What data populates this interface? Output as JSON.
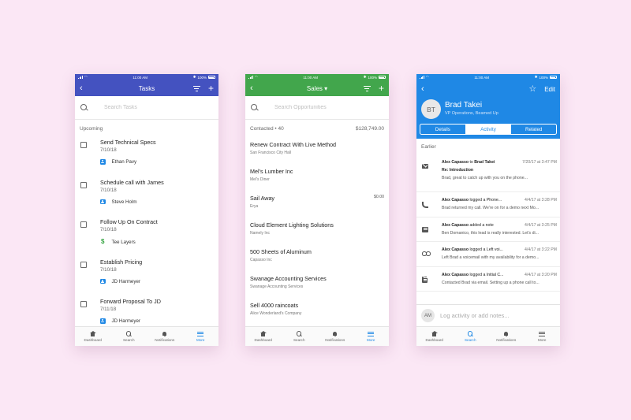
{
  "colors": {
    "background": "#fbe7f5",
    "tasks_accent": "#4452c0",
    "sales_accent": "#42a64c",
    "contact_accent": "#1f88e5"
  },
  "statusbar": {
    "time": "11:00 AM",
    "battery": "100%",
    "bluetooth": "✱"
  },
  "tabbar": {
    "dashboard": "Dashboard",
    "search": "Search",
    "notifications": "Notifications",
    "more": "More"
  },
  "tasks": {
    "title": "Tasks",
    "back": "‹",
    "plus": "+",
    "search_placeholder": "Search Tasks",
    "section": "Upcoming",
    "items": [
      {
        "title": "Send Technical Specs",
        "date": "7/10/18",
        "owner": "Ethan Pavy",
        "owner_icon": "person-icon"
      },
      {
        "title": "Schedule call with James",
        "date": "7/10/18",
        "owner": "Steve Holm",
        "owner_icon": "person-icon"
      },
      {
        "title": "Follow Up On Contract",
        "date": "7/10/18",
        "owner": "Tee Layers",
        "owner_icon": "dollar-icon"
      },
      {
        "title": "Establish Pricing",
        "date": "7/10/18",
        "owner": "JD Harmeyer",
        "owner_icon": "person-icon"
      },
      {
        "title": "Forward Proposal To JD",
        "date": "7/11/18",
        "owner": "JD Harmeyer",
        "owner_icon": "person-icon"
      }
    ]
  },
  "sales": {
    "title": "Sales ▾",
    "back": "‹",
    "plus": "+",
    "search_placeholder": "Search Opportunities",
    "section": "Contacted • 40",
    "section_total": "$128,749.00",
    "items": [
      {
        "title": "Renew Contract With Live Method",
        "sub": "San Francisco City Hall",
        "amount": ""
      },
      {
        "title": "Mel's Lumber Inc",
        "sub": "Mel's Diner",
        "amount": ""
      },
      {
        "title": "Sail Away",
        "sub": "Erya",
        "amount": "$0.00"
      },
      {
        "title": "Cloud Element Lighting Solutions",
        "sub": "Namely Inc",
        "amount": ""
      },
      {
        "title": "500 Sheets of Aluminum",
        "sub": "Capasso Inc",
        "amount": ""
      },
      {
        "title": "Swanage Accounting Services",
        "sub": "Swanage Accounting Services",
        "amount": ""
      },
      {
        "title": "Sell 4000 raincoats",
        "sub": "Alice Wonderland's Company",
        "amount": ""
      }
    ]
  },
  "contact": {
    "back": "‹",
    "star": "☆",
    "edit": "Edit",
    "initials": "BT",
    "name": "Brad Takei",
    "role": "VP Operations, Beamed Up",
    "tabs": [
      "Details",
      "Activity",
      "Related"
    ],
    "active_tab": "Activity",
    "section": "Earlier",
    "activities": [
      {
        "icon": "mail-icon",
        "actor": "Alex Capasso",
        "verb": " to ",
        "target": "Brad Takei",
        "time": "7/20/17 at 3:47 PM",
        "subject": "Re: Introduction",
        "body": "Brad, great to catch up with you on the phone..."
      },
      {
        "icon": "phone-icon",
        "actor": "Alex Capasso",
        "verb": " logged a Phone...",
        "target": "",
        "time": "4/4/17 at 3:28 PM",
        "subject": "",
        "body": "Brad returned my call. We're on for a demo next Mo..."
      },
      {
        "icon": "note-icon",
        "actor": "Alex Capasso",
        "verb": " added a note",
        "target": "",
        "time": "4/4/17 at 3:25 PM",
        "subject": "",
        "body": "Ben Domanico, this lead is really interested. Let's di..."
      },
      {
        "icon": "voicemail-icon",
        "actor": "Alex Capasso",
        "verb": " logged a Left voi...",
        "target": "",
        "time": "4/4/17 at 3:22 PM",
        "subject": "",
        "body": "Left Brad a voicemail with my availability for a demo..."
      },
      {
        "icon": "clipboard-icon",
        "actor": "Alex Capasso",
        "verb": " logged a Initial C...",
        "target": "",
        "time": "4/4/17 at 3:20 PM",
        "subject": "",
        "body": "Contacted Brad via email. Setting up a phone call to..."
      }
    ],
    "log_initials": "AM",
    "log_placeholder": "Log activity or add notes..."
  }
}
